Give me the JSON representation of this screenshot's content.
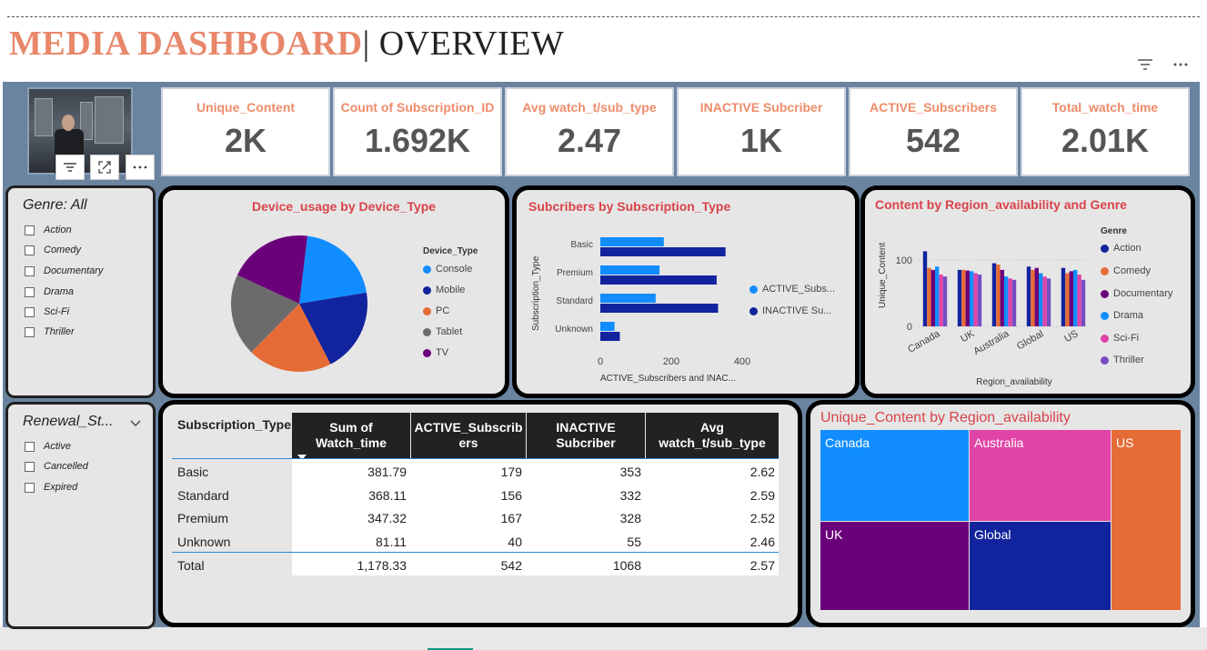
{
  "header": {
    "title_main": "MEDIA DASHBOARD",
    "title_sep": "|",
    "title_sub": " OVERVIEW",
    "filter_icon": "filter-icon",
    "more_icon": "more-icon"
  },
  "image_toolbar": {
    "filter_icon": "filter-icon",
    "expand_icon": "focus-mode-icon",
    "more_icon": "more-icon"
  },
  "kpis": [
    {
      "label": "Unique_Content",
      "value": "2K"
    },
    {
      "label": "Count of Subscription_ID",
      "value": "1.692K"
    },
    {
      "label": "Avg watch_t/sub_type",
      "value": "2.47"
    },
    {
      "label": "INACTIVE Subcriber",
      "value": "1K"
    },
    {
      "label": "ACTIVE_Subscribers",
      "value": "542"
    },
    {
      "label": "Total_watch_time",
      "value": "2.01K"
    }
  ],
  "genre_slicer": {
    "title": "Genre: All",
    "items": [
      "Action",
      "Comedy",
      "Documentary",
      "Drama",
      "Sci-Fi",
      "Thriller"
    ]
  },
  "renewal_slicer": {
    "title": "Renewal_St...",
    "items": [
      "Active",
      "Cancelled",
      "Expired"
    ]
  },
  "device_chart": {
    "title": "Device_usage by Device_Type",
    "chart_data": {
      "type": "pie",
      "legend_title": "Device_Type",
      "labels": [
        "Console",
        "Mobile",
        "PC",
        "Tablet",
        "TV"
      ],
      "values": [
        20.5,
        20.0,
        20.0,
        19.5,
        20.0
      ],
      "colors": [
        "#118dff",
        "#12239e",
        "#e66c37",
        "#6b6b6b",
        "#6b007b"
      ],
      "legend_position": "right"
    }
  },
  "subs_chart": {
    "title": "Subcribers by Subscription_Type",
    "chart_data": {
      "type": "bar",
      "orientation": "horizontal",
      "categories": [
        "Basic",
        "Premium",
        "Standard",
        "Unknown"
      ],
      "series": [
        {
          "name": "ACTIVE_Subs...",
          "values": [
            179,
            167,
            156,
            40
          ],
          "color": "#118dff"
        },
        {
          "name": "INACTIVE Su...",
          "values": [
            353,
            328,
            332,
            55
          ],
          "color": "#12239e"
        }
      ],
      "xlabel": "ACTIVE_Subscribers and INAC...",
      "ylabel": "Subscription_Type",
      "xlim": [
        0,
        400
      ],
      "xticks": [
        "0",
        "200",
        "400"
      ]
    }
  },
  "region_chart": {
    "title": "Content by Region_availability and Genre",
    "chart_data": {
      "type": "bar",
      "categories": [
        "Canada",
        "UK",
        "Australia",
        "Global",
        "US"
      ],
      "series": [
        {
          "name": "Action",
          "values": [
            113,
            85,
            95,
            90,
            88
          ],
          "color": "#12239e"
        },
        {
          "name": "Comedy",
          "values": [
            88,
            85,
            93,
            85,
            80
          ],
          "color": "#e66c37"
        },
        {
          "name": "Documentary",
          "values": [
            85,
            84,
            85,
            88,
            83
          ],
          "color": "#6b007b"
        },
        {
          "name": "Drama",
          "values": [
            90,
            83,
            75,
            80,
            85
          ],
          "color": "#118dff"
        },
        {
          "name": "Sci-Fi",
          "values": [
            78,
            80,
            72,
            75,
            78
          ],
          "color": "#e044a7"
        },
        {
          "name": "Thriller",
          "values": [
            75,
            78,
            70,
            72,
            70
          ],
          "color": "#744ec2"
        }
      ],
      "ylabel": "Unique_Content",
      "xlabel": "Region_availability",
      "legend_title": "Genre",
      "yticks": [
        "0",
        "100"
      ],
      "ylim": [
        0,
        130
      ]
    }
  },
  "table": {
    "headers": [
      "Subscription_Type",
      "Sum of\nWatch_time",
      "ACTIVE_Subscrib\ners",
      "INACTIVE\nSubcriber",
      "Avg\nwatch_t/sub_type"
    ],
    "sort_icon": "sort-desc-icon",
    "rows": [
      [
        "Basic",
        "381.79",
        "179",
        "353",
        "2.62"
      ],
      [
        "Standard",
        "368.11",
        "156",
        "332",
        "2.59"
      ],
      [
        "Premium",
        "347.32",
        "167",
        "328",
        "2.52"
      ],
      [
        "Unknown",
        "81.11",
        "40",
        "55",
        "2.46"
      ]
    ],
    "total": [
      "Total",
      "1,178.33",
      "542",
      "1068",
      "2.57"
    ]
  },
  "treemap": {
    "title": "Unique_Content by Region_availability",
    "chart_data": {
      "type": "treemap",
      "labels": [
        "Canada",
        "Australia",
        "US",
        "UK",
        "Global"
      ],
      "colors": [
        "#118dff",
        "#e044a7",
        "#e66c37",
        "#6b007b",
        "#12239e"
      ]
    }
  }
}
